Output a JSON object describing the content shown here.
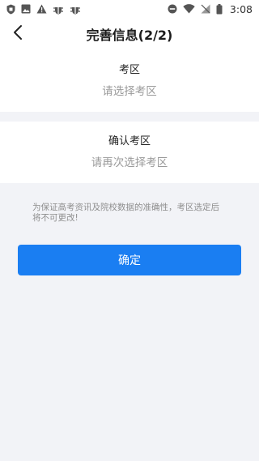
{
  "status_bar": {
    "time": "3:08",
    "left_icons": [
      "shield-icon",
      "image-icon",
      "warning-icon",
      "bug-icon",
      "bug-icon"
    ],
    "right_icons": [
      "do-not-disturb-icon",
      "wifi-icon",
      "no-sim-icon",
      "battery-icon"
    ]
  },
  "header": {
    "title": "完善信息(2/2)",
    "back_icon": "chevron-left-icon"
  },
  "form": {
    "exam_area": {
      "label": "考区",
      "placeholder": "请选择考区"
    },
    "confirm_exam_area": {
      "label": "确认考区",
      "placeholder": "请再次选择考区"
    },
    "notice": "为保证高考资讯及院校数据的准确性，考区选定后将不可更改!"
  },
  "actions": {
    "confirm_label": "确定"
  },
  "colors": {
    "primary": "#1a7ef2",
    "background": "#f2f3f7",
    "placeholder": "#9a9a9a",
    "notice": "#8e8e8e"
  }
}
